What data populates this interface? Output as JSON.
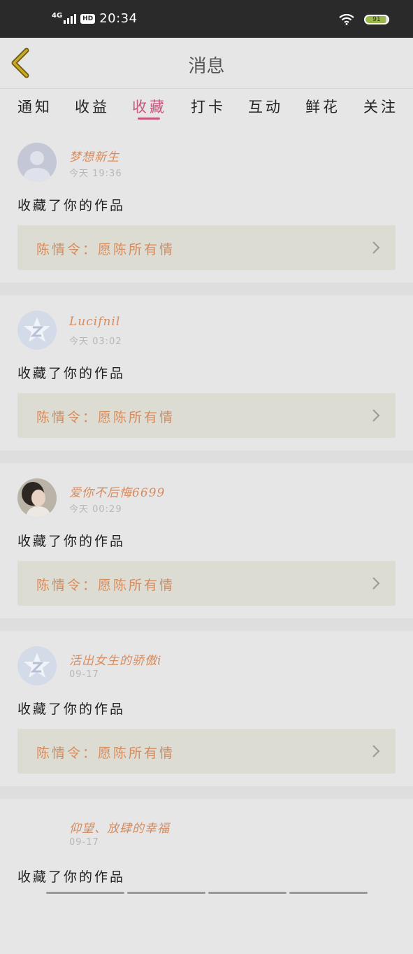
{
  "status_bar": {
    "network": "4G",
    "hd": "HD",
    "time": "20:34",
    "battery": "91"
  },
  "header": {
    "title": "消息"
  },
  "tabs": [
    {
      "label": "通知",
      "active": false
    },
    {
      "label": "收益",
      "active": false
    },
    {
      "label": "收藏",
      "active": true
    },
    {
      "label": "打卡",
      "active": false
    },
    {
      "label": "互动",
      "active": false
    },
    {
      "label": "鲜花",
      "active": false
    },
    {
      "label": "关注",
      "active": false
    }
  ],
  "messages": [
    {
      "username": "梦想新生",
      "time": "今天 19:36",
      "action": "收藏了你的作品",
      "work": "陈情令：愿陈所有情",
      "avatar": "default-person-icon"
    },
    {
      "username": "Lucifnil",
      "time": "今天 03:02",
      "action": "收藏了你的作品",
      "work": "陈情令：愿陈所有情",
      "avatar": "qq-logo-icon"
    },
    {
      "username": "爱你不后悔6699",
      "time": "今天 00:29",
      "action": "收藏了你的作品",
      "work": "陈情令：愿陈所有情",
      "avatar": "user-photo"
    },
    {
      "username": "活出女生的骄傲i",
      "time": "09-17",
      "action": "收藏了你的作品",
      "work": "陈情令：愿陈所有情",
      "avatar": "qq-logo-icon"
    },
    {
      "username": "仰望、放肆的幸福",
      "time": "09-17",
      "action": "收藏了你的作品",
      "work": "",
      "avatar": ""
    }
  ],
  "colors": {
    "accent": "#c65880",
    "username": "#d58c60",
    "background": "#e6e6e6"
  }
}
